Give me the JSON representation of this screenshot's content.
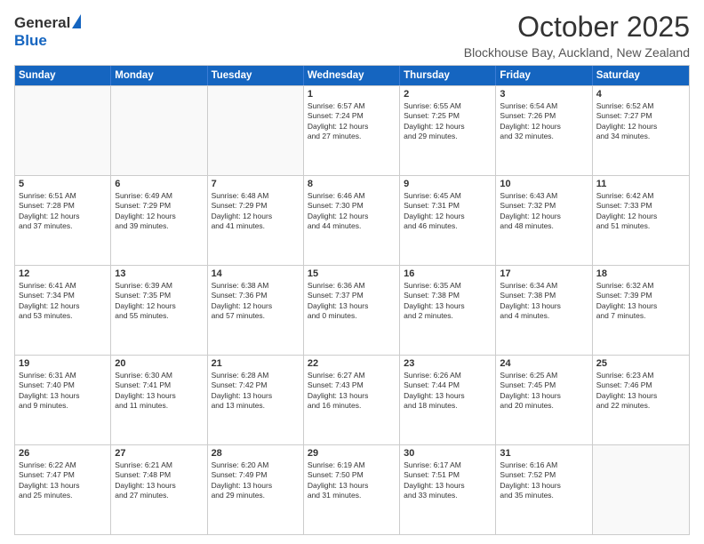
{
  "header": {
    "logo_general": "General",
    "logo_blue": "Blue",
    "month_title": "October 2025",
    "location": "Blockhouse Bay, Auckland, New Zealand"
  },
  "calendar": {
    "days_of_week": [
      "Sunday",
      "Monday",
      "Tuesday",
      "Wednesday",
      "Thursday",
      "Friday",
      "Saturday"
    ],
    "rows": [
      [
        {
          "day": "",
          "content": ""
        },
        {
          "day": "",
          "content": ""
        },
        {
          "day": "",
          "content": ""
        },
        {
          "day": "1",
          "content": "Sunrise: 6:57 AM\nSunset: 7:24 PM\nDaylight: 12 hours\nand 27 minutes."
        },
        {
          "day": "2",
          "content": "Sunrise: 6:55 AM\nSunset: 7:25 PM\nDaylight: 12 hours\nand 29 minutes."
        },
        {
          "day": "3",
          "content": "Sunrise: 6:54 AM\nSunset: 7:26 PM\nDaylight: 12 hours\nand 32 minutes."
        },
        {
          "day": "4",
          "content": "Sunrise: 6:52 AM\nSunset: 7:27 PM\nDaylight: 12 hours\nand 34 minutes."
        }
      ],
      [
        {
          "day": "5",
          "content": "Sunrise: 6:51 AM\nSunset: 7:28 PM\nDaylight: 12 hours\nand 37 minutes."
        },
        {
          "day": "6",
          "content": "Sunrise: 6:49 AM\nSunset: 7:29 PM\nDaylight: 12 hours\nand 39 minutes."
        },
        {
          "day": "7",
          "content": "Sunrise: 6:48 AM\nSunset: 7:29 PM\nDaylight: 12 hours\nand 41 minutes."
        },
        {
          "day": "8",
          "content": "Sunrise: 6:46 AM\nSunset: 7:30 PM\nDaylight: 12 hours\nand 44 minutes."
        },
        {
          "day": "9",
          "content": "Sunrise: 6:45 AM\nSunset: 7:31 PM\nDaylight: 12 hours\nand 46 minutes."
        },
        {
          "day": "10",
          "content": "Sunrise: 6:43 AM\nSunset: 7:32 PM\nDaylight: 12 hours\nand 48 minutes."
        },
        {
          "day": "11",
          "content": "Sunrise: 6:42 AM\nSunset: 7:33 PM\nDaylight: 12 hours\nand 51 minutes."
        }
      ],
      [
        {
          "day": "12",
          "content": "Sunrise: 6:41 AM\nSunset: 7:34 PM\nDaylight: 12 hours\nand 53 minutes."
        },
        {
          "day": "13",
          "content": "Sunrise: 6:39 AM\nSunset: 7:35 PM\nDaylight: 12 hours\nand 55 minutes."
        },
        {
          "day": "14",
          "content": "Sunrise: 6:38 AM\nSunset: 7:36 PM\nDaylight: 12 hours\nand 57 minutes."
        },
        {
          "day": "15",
          "content": "Sunrise: 6:36 AM\nSunset: 7:37 PM\nDaylight: 13 hours\nand 0 minutes."
        },
        {
          "day": "16",
          "content": "Sunrise: 6:35 AM\nSunset: 7:38 PM\nDaylight: 13 hours\nand 2 minutes."
        },
        {
          "day": "17",
          "content": "Sunrise: 6:34 AM\nSunset: 7:38 PM\nDaylight: 13 hours\nand 4 minutes."
        },
        {
          "day": "18",
          "content": "Sunrise: 6:32 AM\nSunset: 7:39 PM\nDaylight: 13 hours\nand 7 minutes."
        }
      ],
      [
        {
          "day": "19",
          "content": "Sunrise: 6:31 AM\nSunset: 7:40 PM\nDaylight: 13 hours\nand 9 minutes."
        },
        {
          "day": "20",
          "content": "Sunrise: 6:30 AM\nSunset: 7:41 PM\nDaylight: 13 hours\nand 11 minutes."
        },
        {
          "day": "21",
          "content": "Sunrise: 6:28 AM\nSunset: 7:42 PM\nDaylight: 13 hours\nand 13 minutes."
        },
        {
          "day": "22",
          "content": "Sunrise: 6:27 AM\nSunset: 7:43 PM\nDaylight: 13 hours\nand 16 minutes."
        },
        {
          "day": "23",
          "content": "Sunrise: 6:26 AM\nSunset: 7:44 PM\nDaylight: 13 hours\nand 18 minutes."
        },
        {
          "day": "24",
          "content": "Sunrise: 6:25 AM\nSunset: 7:45 PM\nDaylight: 13 hours\nand 20 minutes."
        },
        {
          "day": "25",
          "content": "Sunrise: 6:23 AM\nSunset: 7:46 PM\nDaylight: 13 hours\nand 22 minutes."
        }
      ],
      [
        {
          "day": "26",
          "content": "Sunrise: 6:22 AM\nSunset: 7:47 PM\nDaylight: 13 hours\nand 25 minutes."
        },
        {
          "day": "27",
          "content": "Sunrise: 6:21 AM\nSunset: 7:48 PM\nDaylight: 13 hours\nand 27 minutes."
        },
        {
          "day": "28",
          "content": "Sunrise: 6:20 AM\nSunset: 7:49 PM\nDaylight: 13 hours\nand 29 minutes."
        },
        {
          "day": "29",
          "content": "Sunrise: 6:19 AM\nSunset: 7:50 PM\nDaylight: 13 hours\nand 31 minutes."
        },
        {
          "day": "30",
          "content": "Sunrise: 6:17 AM\nSunset: 7:51 PM\nDaylight: 13 hours\nand 33 minutes."
        },
        {
          "day": "31",
          "content": "Sunrise: 6:16 AM\nSunset: 7:52 PM\nDaylight: 13 hours\nand 35 minutes."
        },
        {
          "day": "",
          "content": ""
        }
      ]
    ]
  }
}
